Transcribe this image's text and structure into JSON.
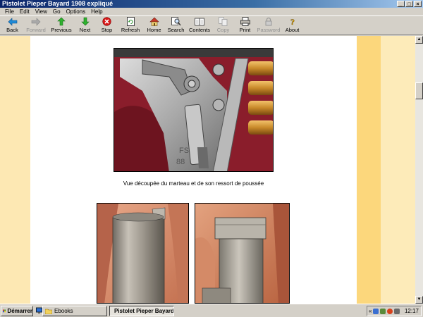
{
  "window": {
    "title": "Pistolet Pieper Bayard 1908 expliqué",
    "buttons": {
      "minimize": "_",
      "maximize": "□",
      "close": "×"
    }
  },
  "menu": [
    "File",
    "Edit",
    "View",
    "Go",
    "Options",
    "Help"
  ],
  "toolbar": [
    {
      "label": "Back",
      "icon": "back-arrow-icon",
      "enabled": true
    },
    {
      "label": "Forward",
      "icon": "forward-arrow-icon",
      "enabled": false
    },
    {
      "label": "Previous",
      "icon": "up-arrow-icon",
      "enabled": true
    },
    {
      "label": "Next",
      "icon": "down-arrow-icon",
      "enabled": true
    },
    {
      "label": "Stop",
      "icon": "stop-icon",
      "enabled": true
    },
    {
      "label": "Refresh",
      "icon": "refresh-icon",
      "enabled": true
    },
    {
      "label": "Home",
      "icon": "home-icon",
      "enabled": true
    },
    {
      "label": "Search",
      "icon": "search-icon",
      "enabled": true
    },
    {
      "label": "Contents",
      "icon": "contents-icon",
      "enabled": true
    },
    {
      "label": "Copy",
      "icon": "copy-icon",
      "enabled": false
    },
    {
      "label": "Print",
      "icon": "print-icon",
      "enabled": true
    },
    {
      "label": "Password",
      "icon": "password-icon",
      "enabled": false
    },
    {
      "label": "About",
      "icon": "about-icon",
      "enabled": true
    }
  ],
  "page": {
    "photo1_engraving": "FS\n88",
    "caption": "Vue découpée du marteau et de son ressort de poussée"
  },
  "taskbar": {
    "start_label": "Démarrer",
    "tasks": [
      {
        "label": "Ebooks",
        "active": false
      },
      {
        "label": "Pistolet Pieper Bayard...",
        "active": true
      }
    ],
    "clock": "12:17"
  },
  "colors": {
    "left_margin": "#fde8b3",
    "accent_stripe": "#fcd77c",
    "right_margin": "#fdebb9",
    "titlebar": "#0a246a"
  }
}
